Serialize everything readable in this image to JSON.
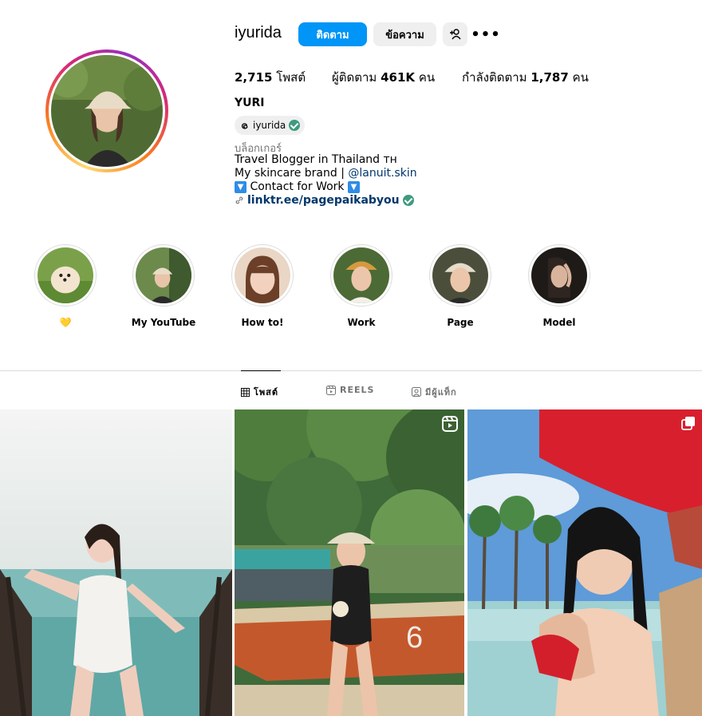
{
  "profile": {
    "username": "iyurida",
    "follow_label": "ติดตาม",
    "message_label": "ข้อความ",
    "add_user_icon": "add-user-icon",
    "more_label": "•••",
    "stats": {
      "posts_count": "2,715",
      "posts_label": "โพสต์",
      "followers_label": "ผู้ติดตาม",
      "followers_count": "461K",
      "followers_unit": "คน",
      "following_label": "กำลังติดตาม",
      "following_count": "1,787",
      "following_unit": "คน"
    },
    "full_name": "YURI",
    "threads_handle": "iyurida",
    "category": "บล็อกเกอร์",
    "bio_line1": "Travel Blogger in Thailand ᴛʜ",
    "bio_line2_prefix": "My skincare brand | ",
    "bio_line2_mention": "@lanuit.skin",
    "bio_line3": "Contact for Work",
    "bio_arrow": "🔽",
    "link": "linktr.ee/pagepaikabyou"
  },
  "highlights": [
    {
      "label": "💛"
    },
    {
      "label": "My YouTube"
    },
    {
      "label": "How to!"
    },
    {
      "label": "Work"
    },
    {
      "label": "Page"
    },
    {
      "label": "Model"
    }
  ],
  "tabs": [
    {
      "label": "โพสต์",
      "icon": "grid-icon",
      "active": true
    },
    {
      "label": "REELS",
      "icon": "reels-icon",
      "active": false
    },
    {
      "label": "มีผู้แท็ก",
      "icon": "tagged-icon",
      "active": false
    }
  ],
  "posts": [
    {
      "type": "photo"
    },
    {
      "type": "reel",
      "badge": "reels-icon",
      "boat_number": "6"
    },
    {
      "type": "carousel",
      "badge": "carousel-icon"
    }
  ],
  "colors": {
    "follow_button": "#0095f6",
    "link": "#00376b",
    "verified": "#3e9b7e"
  }
}
